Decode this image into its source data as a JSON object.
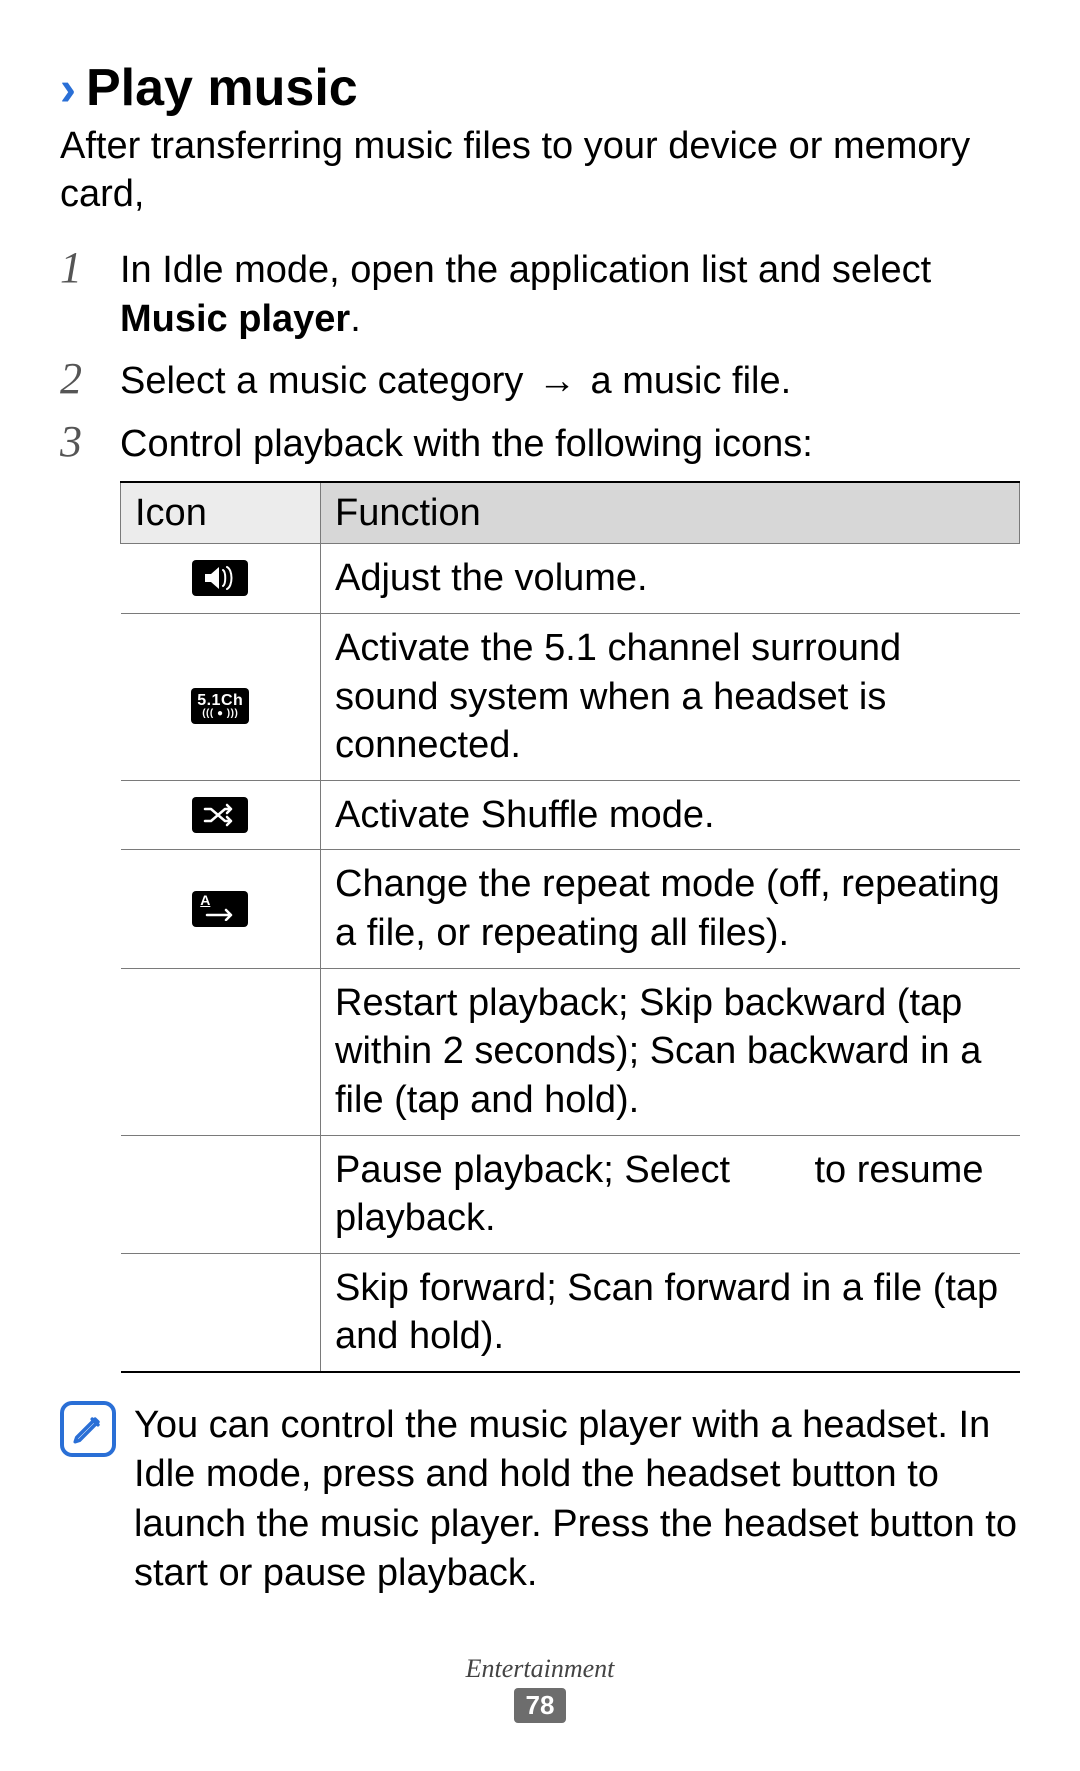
{
  "heading": {
    "chevron": "›",
    "title": "Play music"
  },
  "intro": "After transferring music files to your device or memory card,",
  "steps": {
    "s1": {
      "num": "1",
      "pre": "In Idle mode, open the application list and select ",
      "bold": "Music player",
      "post": "."
    },
    "s2": {
      "num": "2",
      "pre": "Select a music category ",
      "arrow": "→",
      "post": " a music file."
    },
    "s3": {
      "num": "3",
      "text": "Control playback with the following icons:"
    }
  },
  "table": {
    "head_icon": "Icon",
    "head_func": "Function",
    "rows": {
      "r1": "Adjust the volume.",
      "r2": "Activate the 5.1 channel surround sound system when a headset is connected.",
      "r3": "Activate Shuffle mode.",
      "r4": "Change the repeat mode (off, repeating a file, or repeating all files).",
      "r5": "Restart playback; Skip backward (tap within 2 seconds); Scan backward in a file (tap and hold).",
      "r6_pre": "Pause playback; Select ",
      "r6_post": " to resume playback.",
      "r7": "Skip forward; Scan forward in a file (tap and hold)."
    }
  },
  "note": "You can control the music player with a headset. In Idle mode, press and hold the headset button to launch the music player. Press the headset button to start or pause playback.",
  "footer": {
    "category": "Entertainment",
    "page": "78"
  },
  "icon_labels": {
    "fiveone_top": "5.1Ch",
    "fiveone_bottom": "((( ● )))",
    "repeat_a": "A"
  }
}
